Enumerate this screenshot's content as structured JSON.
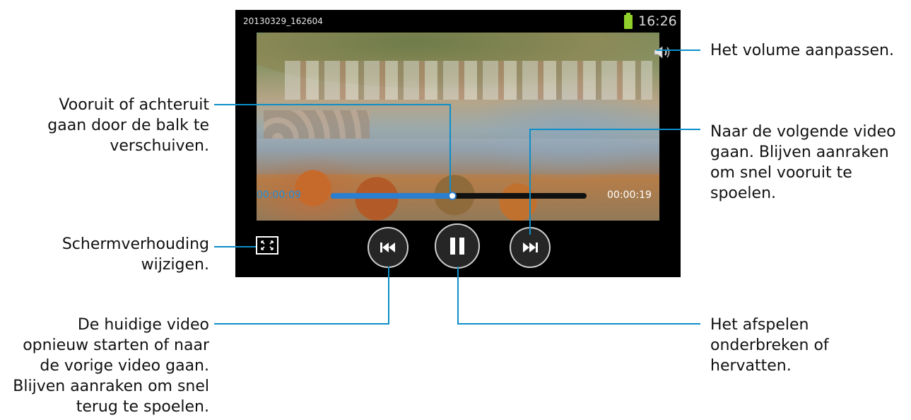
{
  "status_bar": {
    "filename": "20130329_162604",
    "clock": "16:26"
  },
  "player": {
    "current_time": "00:00:09",
    "total_time": "00:00:19",
    "progress": 0.47
  },
  "icons": [
    "volume-icon",
    "aspect-ratio-icon",
    "previous-icon",
    "pause-icon",
    "next-icon",
    "battery-icon"
  ],
  "callouts": {
    "volume": "Het volume aanpassen.",
    "seek": [
      "Vooruit of achteruit",
      "gaan door de balk te",
      "verschuiven."
    ],
    "next": [
      "Naar de volgende video",
      "gaan. Blijven aanraken",
      "om snel vooruit te",
      "spoelen."
    ],
    "aspect": [
      "Schermverhouding",
      "wijzigen."
    ],
    "previous": [
      "De huidige video",
      "opnieuw starten of naar",
      "de vorige video gaan.",
      "Blijven aanraken om snel",
      "terug te spoelen."
    ],
    "pause": [
      "Het afspelen",
      "onderbreken of",
      "hervatten."
    ]
  },
  "colors": {
    "accent": "#0c8ec9",
    "progress": "#2a7fd0",
    "battery": "#8fd12a"
  }
}
